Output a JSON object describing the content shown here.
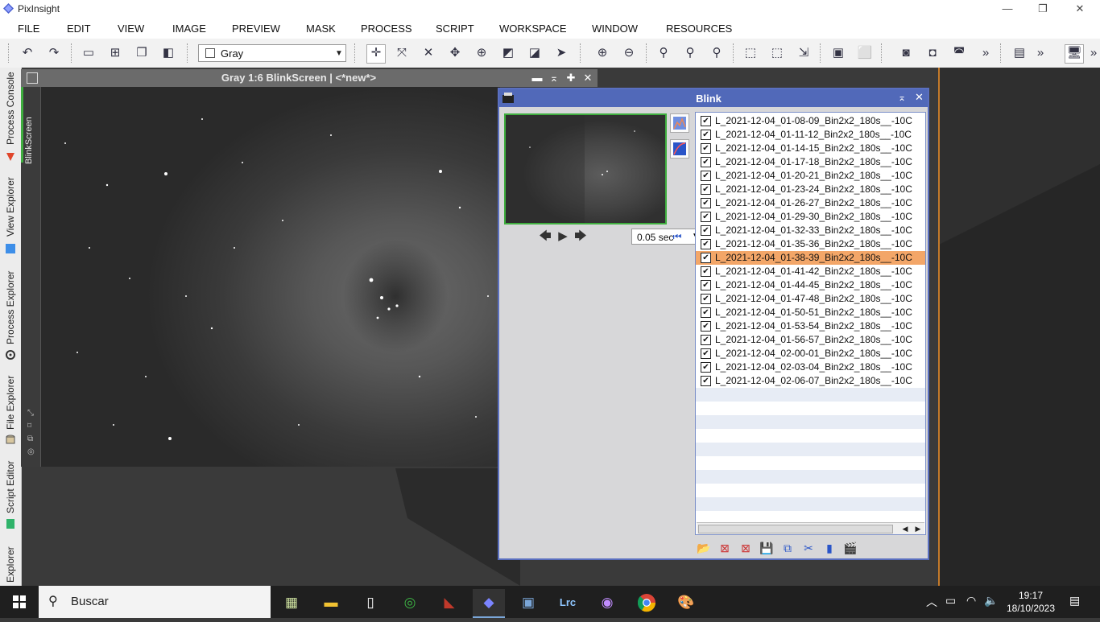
{
  "window": {
    "title": "PixInsight",
    "controls": {
      "minimize": "—",
      "restore": "❐",
      "close": "✕"
    }
  },
  "menu": [
    "FILE",
    "EDIT",
    "VIEW",
    "IMAGE",
    "PREVIEW",
    "MASK",
    "PROCESS",
    "SCRIPT",
    "WORKSPACE",
    "WINDOW",
    "RESOURCES"
  ],
  "toolbar": {
    "colorspace_value": "Gray",
    "overflow": "»"
  },
  "left_tabs": [
    "Process Console",
    "View Explorer",
    "Process Explorer",
    "File Explorer",
    "Script Editor",
    "Explorer"
  ],
  "image_window": {
    "title": "Gray 1:6 BlinkScreen | <*new*>",
    "side_label": "BlinkScreen"
  },
  "blink": {
    "title": "Blink",
    "speed": "0.05 sec",
    "files": [
      "L_2021-12-04_01-08-09_Bin2x2_180s__-10C",
      "L_2021-12-04_01-11-12_Bin2x2_180s__-10C",
      "L_2021-12-04_01-14-15_Bin2x2_180s__-10C",
      "L_2021-12-04_01-17-18_Bin2x2_180s__-10C",
      "L_2021-12-04_01-20-21_Bin2x2_180s__-10C",
      "L_2021-12-04_01-23-24_Bin2x2_180s__-10C",
      "L_2021-12-04_01-26-27_Bin2x2_180s__-10C",
      "L_2021-12-04_01-29-30_Bin2x2_180s__-10C",
      "L_2021-12-04_01-32-33_Bin2x2_180s__-10C",
      "L_2021-12-04_01-35-36_Bin2x2_180s__-10C",
      "L_2021-12-04_01-38-39_Bin2x2_180s__-10C",
      "L_2021-12-04_01-41-42_Bin2x2_180s__-10C",
      "L_2021-12-04_01-44-45_Bin2x2_180s__-10C",
      "L_2021-12-04_01-47-48_Bin2x2_180s__-10C",
      "L_2021-12-04_01-50-51_Bin2x2_180s__-10C",
      "L_2021-12-04_01-53-54_Bin2x2_180s__-10C",
      "L_2021-12-04_01-56-57_Bin2x2_180s__-10C",
      "L_2021-12-04_02-00-01_Bin2x2_180s__-10C",
      "L_2021-12-04_02-03-04_Bin2x2_180s__-10C",
      "L_2021-12-04_02-06-07_Bin2x2_180s__-10C"
    ],
    "selected_index": 10,
    "checkmark": "✔"
  },
  "taskbar": {
    "search_placeholder": "Buscar",
    "time": "19:17",
    "date": "18/10/2023",
    "lrc_label": "Lrc"
  },
  "colors": {
    "accent_blue": "#5169b9",
    "selection_orange": "#f3a668",
    "preview_border": "#3fae3f"
  }
}
